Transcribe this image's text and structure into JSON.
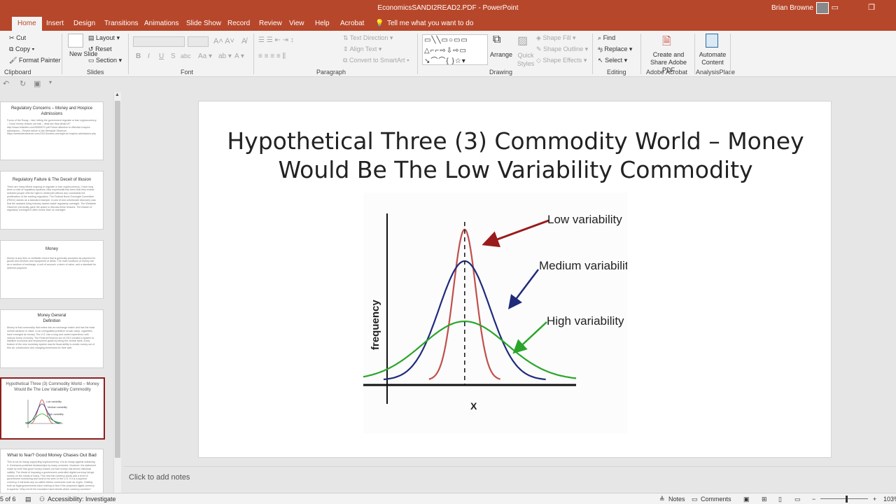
{
  "titlebar": {
    "doc_title": "EconomicsSANDI2READ2.PDF - PowerPoint",
    "user_name": "Brian Browne"
  },
  "tabs": [
    "Home",
    "Insert",
    "Design",
    "Transitions",
    "Animations",
    "Slide Show",
    "Record",
    "Review",
    "View",
    "Help",
    "Acrobat"
  ],
  "tell_me": "Tell me what you want to do",
  "ribbon": {
    "clipboard": {
      "cut": "Cut",
      "copy": "Copy",
      "format_painter": "Format Painter",
      "label": "Clipboard"
    },
    "slides": {
      "new_slide": "New Slide",
      "layout": "Layout",
      "reset": "Reset",
      "section": "Section",
      "label": "Slides"
    },
    "font": {
      "label": "Font",
      "bold": "B",
      "italic": "I",
      "underline": "U",
      "strike": "S",
      "spacing": "abc"
    },
    "paragraph": {
      "label": "Paragraph",
      "text_direction": "Text Direction",
      "align_text": "Align Text",
      "smartart": "Convert to SmartArt"
    },
    "drawing": {
      "label": "Drawing",
      "arrange": "Arrange",
      "quick_styles": "Quick Styles",
      "shape_fill": "Shape Fill",
      "shape_outline": "Shape Outline",
      "shape_effects": "Shape Effects"
    },
    "editing": {
      "label": "Editing",
      "find": "Find",
      "replace": "Replace",
      "select": "Select"
    },
    "adobe": {
      "label": "Adobe Acrobat",
      "create_share": "Create and Share Adobe PDF"
    },
    "analysis": {
      "label": "AnalysisPlace",
      "automate": "Automate Content"
    }
  },
  "thumbnails": [
    {
      "title": "Regulatory Concerns – Money and Hospice Admissions",
      "body": "Focus of the Essay – fact: letting the government regulate or ban cryptocurrency – Good money chases out bad – what are they afraid of? http://www.hhsletter.com/SBDMTX.pdf Future attention to effective hospice admissions – Recent article in the Westside Observer https://westsideobserver.com/23/2-flooded-oversight-at-hospice-admissions.php"
    },
    {
      "title": "Regulatory Failure & The Deceit of Illusion",
      "body": "There are many efforts ongoing to regulate or ban cryptocurrency. I have long been a critic of regulatory systems, fully experiential has been that they endow selected people with the right to reinterpret without any constraints the proliferation of the existing regulation. The Federal Bond Oversight Committee (FBOC) stands as a standard example. A cost of and unfortunate discovery was that the assisted living industry lacked viable regulatory oversight. The Westside Observer previously gave the space to discuss these lessons. The illusion of regulatory oversight is often worse than no oversight."
    },
    {
      "title": "Money",
      "body": "Money is any item or verifiable record that is generally accepted as payment for goods and services and repayment of debts. The main functions of money are as a medium of exchange, a unit of account, a store of value, and a standard for deferred payment."
    },
    {
      "title": "Money General Definition",
      "body": "Money is that commodity that enters into an exchange matrix and has the least overall variance in value. In an unregulated primitive oil-war camp, cigarettes have emerged as money. The U.S. has a long and varied experience with various forms of money. The Federal Reserve Act of 1913 created a system to stabilize economic and employment goals by being the central bank. A key feature of the new monetary system was its fiscal ability to create money out of thin air, construction and charging Americans for their wait."
    },
    {
      "title": "Hypothetical Three (3) Commodity World – Money Would Be The Low Variability Commodity",
      "body": ""
    },
    {
      "title": "What to fear? Good Money Chases Out Bad",
      "body": "This is not an essay supporting cryptocurrency. It is an essay against outlawing it. Greshams predicted dictatorships by many centuries. However, the statement made by both that good money chases out bad money has shown historical validity. The threat of imposing a government-controlled digital currency brings money on the minds of many. This new fiat currency would add a level of government monitoring and control not seen in the U.S. If it is a superior currency, it will draw any so-called inferior currencies such as crypto. Holding both as legal governments have nothing to fear if the proposed digital currency is superior. Why not let the mundane hand decide which currency survives?"
    }
  ],
  "slide": {
    "title": "Hypothetical Three (3) Commodity World – Money Would Be The Low Variability Commodity"
  },
  "chart_data": {
    "type": "line",
    "title": "",
    "xlabel": "X",
    "ylabel": "frequency",
    "grid": false,
    "annotations": [
      "Low variability",
      "Medium variability",
      "High variability"
    ],
    "series": [
      {
        "name": "Low variability",
        "color": "#c0504d",
        "mean": 0,
        "sd": 0.33,
        "peak": 1.0
      },
      {
        "name": "Medium variability",
        "color": "#1f2a7a",
        "mean": 0,
        "sd": 0.75,
        "peak": 0.79
      },
      {
        "name": "High variability",
        "color": "#2aa52a",
        "mean": 0,
        "sd": 1.25,
        "peak": 0.39
      }
    ],
    "xlim": [
      -3,
      3.3
    ],
    "ylim": [
      0,
      1.05
    ],
    "mean_line": 0
  },
  "notes_placeholder": "Click to add notes",
  "status": {
    "slide_count": "5 of 6",
    "accessibility": "Accessibility: Investigate",
    "notes": "Notes",
    "comments": "Comments",
    "zoom": "103%"
  },
  "colors": {
    "accent": "#b7472a",
    "selected_thumb": "#8e1f1f"
  }
}
